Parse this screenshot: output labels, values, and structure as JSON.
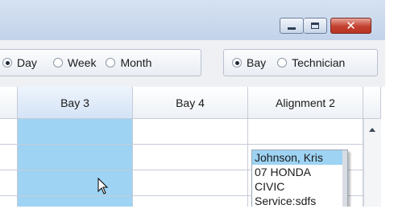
{
  "window": {
    "buttons": {
      "minimize": "minimize-icon",
      "maximize": "maximize-icon",
      "close": "close-icon"
    }
  },
  "view_options": [
    {
      "label": "Day",
      "selected": true
    },
    {
      "label": "Week",
      "selected": false
    },
    {
      "label": "Month",
      "selected": false
    }
  ],
  "group_by": [
    {
      "label": "Bay",
      "selected": true
    },
    {
      "label": "Technician",
      "selected": false
    }
  ],
  "columns": [
    "Bay 3",
    "Bay 4",
    "Alignment 2"
  ],
  "appointment": {
    "customer": "Johnson, Kris",
    "vehicle_line1": "07 HONDA",
    "vehicle_line2": "CIVIC",
    "service": "Service:sdfs"
  },
  "colors": {
    "selected_cell": "#9ed3f3",
    "close_button": "#c4412f"
  }
}
